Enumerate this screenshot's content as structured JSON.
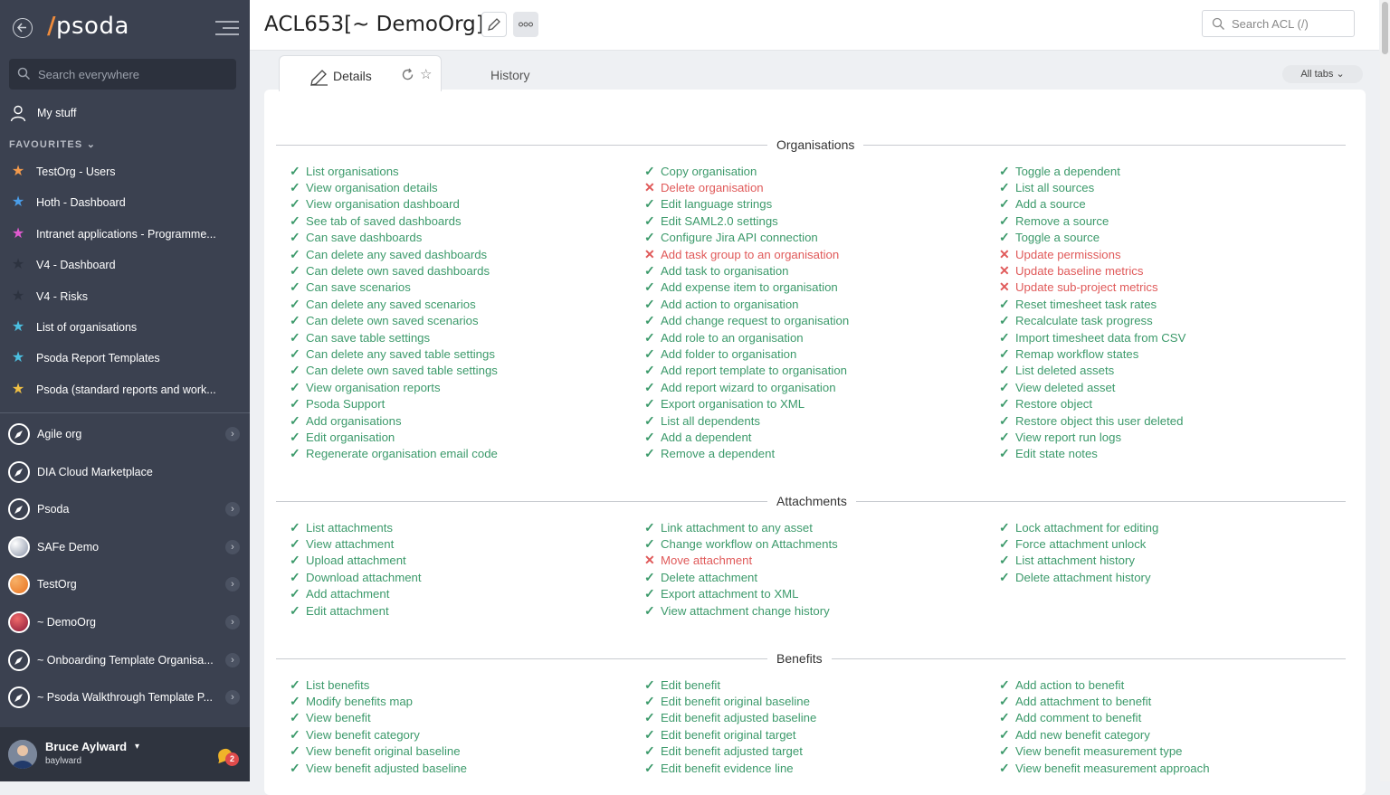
{
  "sidebar": {
    "logo": "psoda",
    "search_placeholder": "Search everywhere",
    "my_stuff": "My stuff",
    "favourites_heading": "FAVOURITES",
    "favourites": [
      {
        "label": "TestOrg - Users",
        "color": "#f39a4c"
      },
      {
        "label": "Hoth - Dashboard",
        "color": "#4a9de8"
      },
      {
        "label": "Intranet applications - Programme...",
        "color": "#e05ad0"
      },
      {
        "label": "V4 - Dashboard",
        "color": "#2d3340"
      },
      {
        "label": "V4 - Risks",
        "color": "#2d3340"
      },
      {
        "label": "List of organisations",
        "color": "#4bbfe0"
      },
      {
        "label": "Psoda Report Templates",
        "color": "#4bbfe0"
      },
      {
        "label": "Psoda (standard reports and work...",
        "color": "#f0c044"
      }
    ],
    "orgs": [
      {
        "label": "Agile org",
        "chevron": true
      },
      {
        "label": "DIA Cloud Marketplace",
        "chevron": false
      },
      {
        "label": "Psoda",
        "chevron": true
      },
      {
        "label": "SAFe Demo",
        "chevron": true
      },
      {
        "label": "TestOrg",
        "chevron": true
      },
      {
        "label": "~ DemoOrg",
        "chevron": true
      },
      {
        "label": "~ Onboarding Template Organisa...",
        "chevron": true
      },
      {
        "label": "~ Psoda Walkthrough Template P...",
        "chevron": true
      }
    ],
    "user": {
      "name": "Bruce Aylward",
      "login": "baylward",
      "notifications": "2"
    }
  },
  "header": {
    "title": "ACL653[~ DemoOrg]",
    "search_placeholder": "Search ACL (/)"
  },
  "tabs": {
    "details": "Details",
    "history": "History",
    "all_tabs": "All tabs"
  },
  "sections": [
    {
      "title": "Organisations",
      "columns": [
        [
          {
            "t": "List organisations",
            "ok": true
          },
          {
            "t": "View organisation details",
            "ok": true
          },
          {
            "t": "View organisation dashboard",
            "ok": true
          },
          {
            "t": "See tab of saved dashboards",
            "ok": true
          },
          {
            "t": "Can save dashboards",
            "ok": true
          },
          {
            "t": "Can delete any saved dashboards",
            "ok": true
          },
          {
            "t": "Can delete own saved dashboards",
            "ok": true
          },
          {
            "t": "Can save scenarios",
            "ok": true
          },
          {
            "t": "Can delete any saved scenarios",
            "ok": true
          },
          {
            "t": "Can delete own saved scenarios",
            "ok": true
          },
          {
            "t": "Can save table settings",
            "ok": true
          },
          {
            "t": "Can delete any saved table settings",
            "ok": true
          },
          {
            "t": "Can delete own saved table settings",
            "ok": true
          },
          {
            "t": "View organisation reports",
            "ok": true
          },
          {
            "t": "Psoda Support",
            "ok": true
          },
          {
            "t": "Add organisations",
            "ok": true
          },
          {
            "t": "Edit organisation",
            "ok": true
          },
          {
            "t": "Regenerate organisation email code",
            "ok": true
          }
        ],
        [
          {
            "t": "Copy organisation",
            "ok": true
          },
          {
            "t": "Delete organisation",
            "ok": false
          },
          {
            "t": "Edit language strings",
            "ok": true
          },
          {
            "t": "Edit SAML2.0 settings",
            "ok": true
          },
          {
            "t": "Configure Jira API connection",
            "ok": true
          },
          {
            "t": "Add task group to an organisation",
            "ok": false
          },
          {
            "t": "Add task to organisation",
            "ok": true
          },
          {
            "t": "Add expense item to organisation",
            "ok": true
          },
          {
            "t": "Add action to organisation",
            "ok": true
          },
          {
            "t": "Add change request to organisation",
            "ok": true
          },
          {
            "t": "Add role to an organisation",
            "ok": true
          },
          {
            "t": "Add folder to organisation",
            "ok": true
          },
          {
            "t": "Add report template to organisation",
            "ok": true
          },
          {
            "t": "Add report wizard to organisation",
            "ok": true
          },
          {
            "t": "Export organisation to XML",
            "ok": true
          },
          {
            "t": "List all dependents",
            "ok": true
          },
          {
            "t": "Add a dependent",
            "ok": true
          },
          {
            "t": "Remove a dependent",
            "ok": true
          }
        ],
        [
          {
            "t": "Toggle a dependent",
            "ok": true
          },
          {
            "t": "List all sources",
            "ok": true
          },
          {
            "t": "Add a source",
            "ok": true
          },
          {
            "t": "Remove a source",
            "ok": true
          },
          {
            "t": "Toggle a source",
            "ok": true
          },
          {
            "t": "Update permissions",
            "ok": false
          },
          {
            "t": "Update baseline metrics",
            "ok": false
          },
          {
            "t": "Update sub-project metrics",
            "ok": false
          },
          {
            "t": "Reset timesheet task rates",
            "ok": true
          },
          {
            "t": "Recalculate task progress",
            "ok": true
          },
          {
            "t": "Import timesheet data from CSV",
            "ok": true
          },
          {
            "t": "Remap workflow states",
            "ok": true
          },
          {
            "t": "List deleted assets",
            "ok": true
          },
          {
            "t": "View deleted asset",
            "ok": true
          },
          {
            "t": "Restore object",
            "ok": true
          },
          {
            "t": "Restore object this user deleted",
            "ok": true
          },
          {
            "t": "View report run logs",
            "ok": true
          },
          {
            "t": "Edit state notes",
            "ok": true
          }
        ]
      ]
    },
    {
      "title": "Attachments",
      "columns": [
        [
          {
            "t": "List attachments",
            "ok": true
          },
          {
            "t": "View attachment",
            "ok": true
          },
          {
            "t": "Upload attachment",
            "ok": true
          },
          {
            "t": "Download attachment",
            "ok": true
          },
          {
            "t": "Add attachment",
            "ok": true
          },
          {
            "t": "Edit attachment",
            "ok": true
          }
        ],
        [
          {
            "t": "Link attachment to any asset",
            "ok": true
          },
          {
            "t": "Change workflow on Attachments",
            "ok": true
          },
          {
            "t": "Move attachment",
            "ok": false
          },
          {
            "t": "Delete attachment",
            "ok": true
          },
          {
            "t": "Export attachment to XML",
            "ok": true
          },
          {
            "t": "View attachment change history",
            "ok": true
          }
        ],
        [
          {
            "t": "Lock attachment for editing",
            "ok": true
          },
          {
            "t": "Force attachment unlock",
            "ok": true
          },
          {
            "t": "List attachment history",
            "ok": true
          },
          {
            "t": "Delete attachment history",
            "ok": true
          }
        ]
      ]
    },
    {
      "title": "Benefits",
      "columns": [
        [
          {
            "t": "List benefits",
            "ok": true
          },
          {
            "t": "Modify benefits map",
            "ok": true
          },
          {
            "t": "View benefit",
            "ok": true
          },
          {
            "t": "View benefit category",
            "ok": true
          },
          {
            "t": "View benefit original baseline",
            "ok": true
          },
          {
            "t": "View benefit adjusted baseline",
            "ok": true
          }
        ],
        [
          {
            "t": "Edit benefit",
            "ok": true
          },
          {
            "t": "Edit benefit original baseline",
            "ok": true
          },
          {
            "t": "Edit benefit adjusted baseline",
            "ok": true
          },
          {
            "t": "Edit benefit original target",
            "ok": true
          },
          {
            "t": "Edit benefit adjusted target",
            "ok": true
          },
          {
            "t": "Edit benefit evidence line",
            "ok": true
          }
        ],
        [
          {
            "t": "Add action to benefit",
            "ok": true
          },
          {
            "t": "Add attachment to benefit",
            "ok": true
          },
          {
            "t": "Add comment to benefit",
            "ok": true
          },
          {
            "t": "Add new benefit category",
            "ok": true
          },
          {
            "t": "View benefit measurement type",
            "ok": true
          },
          {
            "t": "View benefit measurement approach",
            "ok": true
          }
        ]
      ]
    }
  ]
}
